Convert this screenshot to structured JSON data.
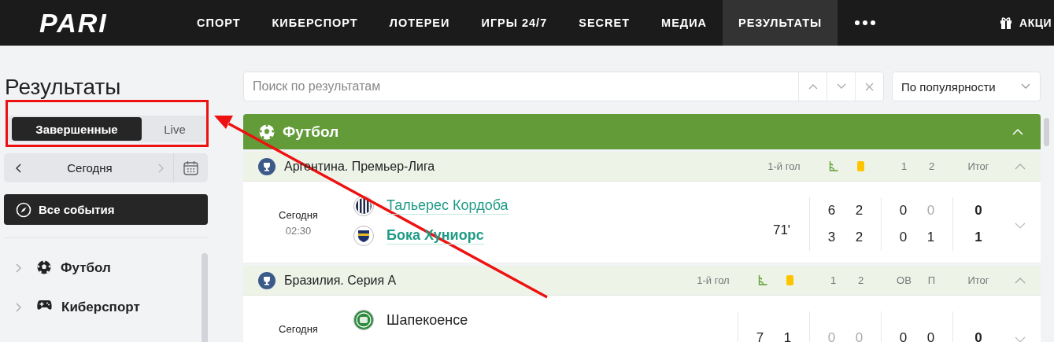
{
  "header": {
    "logo": "PARI",
    "nav": [
      {
        "label": "СПОРТ",
        "selected": false
      },
      {
        "label": "КИБЕРСПОРТ",
        "selected": false
      },
      {
        "label": "ЛОТЕРЕИ",
        "selected": false
      },
      {
        "label": "ИГРЫ 24/7",
        "selected": false
      },
      {
        "label": "SECRET",
        "selected": false
      },
      {
        "label": "МЕДИА",
        "selected": false
      },
      {
        "label": "РЕЗУЛЬТАТЫ",
        "selected": true
      }
    ],
    "promo": "АКЦИ"
  },
  "sidebar": {
    "title": "Результаты",
    "tabs": [
      {
        "label": "Завершенные",
        "selected": true
      },
      {
        "label": "Live",
        "selected": false
      }
    ],
    "date": "Сегодня",
    "all_events": "Все события",
    "sports": [
      {
        "label": "Футбол",
        "kind": "football",
        "expanded": false
      },
      {
        "label": "Киберспорт",
        "kind": "esports",
        "expanded": false
      }
    ]
  },
  "search": {
    "placeholder": "Поиск по результатам"
  },
  "sort": {
    "value": "По популярности"
  },
  "sport": {
    "name": "Футбол",
    "expanded": true,
    "leagues": [
      {
        "name": "Аргентина. Премьер-Лига",
        "expanded": true,
        "groups": [
          [
            {
              "kind": "text",
              "label": "1-й гол"
            }
          ],
          [
            {
              "kind": "corners"
            },
            {
              "kind": "yellow_cards"
            }
          ],
          [
            {
              "kind": "text",
              "label": "1"
            },
            {
              "kind": "text",
              "label": "2"
            }
          ],
          [
            {
              "kind": "text",
              "label": "Итог"
            }
          ]
        ],
        "matches": [
          {
            "date": "Сегодня",
            "time": "02:30",
            "expanded": false,
            "teams": [
              {
                "name": "Тальерес Кордоба",
                "link": true,
                "winner": false,
                "kind": "stripes",
                "cells": [
                  [
                    null
                  ],
                  [
                    {
                      "value": "6",
                      "muted": false
                    },
                    {
                      "value": "2",
                      "muted": false
                    }
                  ],
                  [
                    {
                      "value": "0",
                      "muted": false
                    },
                    {
                      "value": "0",
                      "muted": true
                    }
                  ],
                  [
                    {
                      "value": "0",
                      "muted": false
                    }
                  ]
                ]
              },
              {
                "name": "Бока Хуниорс",
                "link": true,
                "winner": true,
                "kind": "crest",
                "cells": [
                  [
                    {
                      "value": "71'",
                      "muted": false
                    }
                  ],
                  [
                    {
                      "value": "3",
                      "muted": false
                    },
                    {
                      "value": "2",
                      "muted": false
                    }
                  ],
                  [
                    {
                      "value": "0",
                      "muted": false
                    },
                    {
                      "value": "1",
                      "muted": false
                    }
                  ],
                  [
                    {
                      "value": "1",
                      "muted": false
                    }
                  ]
                ]
              }
            ]
          }
        ]
      },
      {
        "name": "Бразилия. Серия А",
        "expanded": true,
        "groups": [
          [
            {
              "kind": "text",
              "label": "1-й гол"
            }
          ],
          [
            {
              "kind": "corners"
            },
            {
              "kind": "yellow_cards"
            }
          ],
          [
            {
              "kind": "text",
              "label": "1"
            },
            {
              "kind": "text",
              "label": "2"
            }
          ],
          [
            {
              "kind": "text",
              "label": "ОВ"
            },
            {
              "kind": "text",
              "label": "П"
            }
          ],
          [
            {
              "kind": "text",
              "label": "Итог"
            }
          ]
        ],
        "matches": [
          {
            "date": "Сегодня",
            "expanded": false,
            "teams": [
              {
                "name": "Шапекоенсе",
                "link": false,
                "winner": false,
                "kind": "green",
                "cells": [
                  [
                    null
                  ],
                  [
                    {
                      "value": "7",
                      "muted": false
                    },
                    {
                      "value": "1",
                      "muted": false
                    }
                  ],
                  [
                    {
                      "value": "0",
                      "muted": true
                    },
                    {
                      "value": "0",
                      "muted": true
                    }
                  ],
                  [
                    {
                      "value": "0",
                      "muted": false
                    },
                    {
                      "value": "0",
                      "muted": false
                    }
                  ],
                  [
                    {
                      "value": "0",
                      "muted": false
                    }
                  ]
                ]
              }
            ]
          }
        ]
      }
    ]
  }
}
